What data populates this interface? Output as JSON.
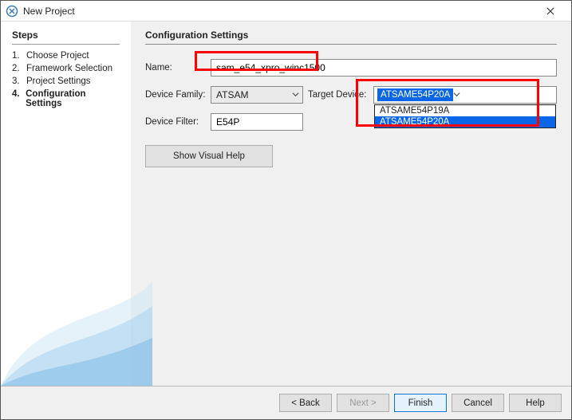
{
  "window": {
    "title": "New Project"
  },
  "sidebar": {
    "heading": "Steps",
    "items": [
      {
        "num": "1.",
        "label": "Choose Project"
      },
      {
        "num": "2.",
        "label": "Framework Selection"
      },
      {
        "num": "3.",
        "label": "Project Settings"
      },
      {
        "num": "4.",
        "label": "Configuration Settings"
      }
    ],
    "current_index": 3
  },
  "main": {
    "heading": "Configuration Settings",
    "name_label": "Name:",
    "name_value": "sam_e54_xpro_winc1500",
    "device_family_label": "Device Family:",
    "device_family_value": "ATSAM",
    "device_filter_label": "Device Filter:",
    "device_filter_value": "E54P",
    "target_device_label": "Target Device:",
    "target_device_value": "ATSAME54P20A",
    "target_dropdown": [
      "ATSAME54P19A",
      "ATSAME54P20A"
    ],
    "target_dropdown_selected_index": 1,
    "visual_help_label": "Show Visual Help"
  },
  "footer": {
    "back": "< Back",
    "next": "Next >",
    "finish": "Finish",
    "cancel": "Cancel",
    "help": "Help"
  }
}
